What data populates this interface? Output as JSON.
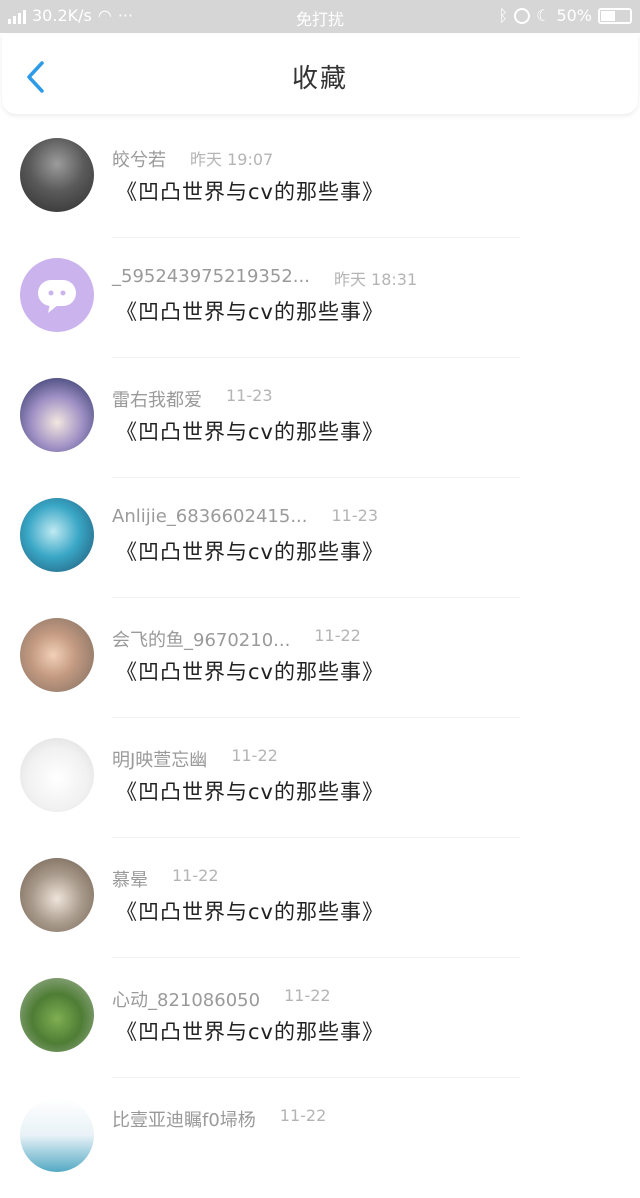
{
  "status_bar": {
    "network_speed": "30.2K/s",
    "dots": "···",
    "mode": "免打扰",
    "battery": "50%"
  },
  "header": {
    "title": "收藏"
  },
  "favorites": [
    {
      "name": "皎兮若",
      "time": "昨天 19:07",
      "subject": "《凹凸世界与cv的那些事》"
    },
    {
      "name": "_595243975219352...",
      "time": "昨天 18:31",
      "subject": "《凹凸世界与cv的那些事》"
    },
    {
      "name": "雷右我都爱",
      "time": "11-23",
      "subject": "《凹凸世界与cv的那些事》"
    },
    {
      "name": "Anlijie_6836602415...",
      "time": "11-23",
      "subject": "《凹凸世界与cv的那些事》"
    },
    {
      "name": "会飞的鱼_9670210...",
      "time": "11-22",
      "subject": "《凹凸世界与cv的那些事》"
    },
    {
      "name": "明J映萱忘幽",
      "time": "11-22",
      "subject": "《凹凸世界与cv的那些事》"
    },
    {
      "name": "慕晕",
      "time": "11-22",
      "subject": "《凹凸世界与cv的那些事》"
    },
    {
      "name": "心动_821086050",
      "time": "11-22",
      "subject": "《凹凸世界与cv的那些事》"
    },
    {
      "name": "比壹亚迪瞩f0埽杨",
      "time": "11-22",
      "subject": ""
    }
  ],
  "colors": {
    "accent": "#2d9be8",
    "status_bar_bg": "#d6d6d6",
    "name_text": "#9a9a9a"
  }
}
